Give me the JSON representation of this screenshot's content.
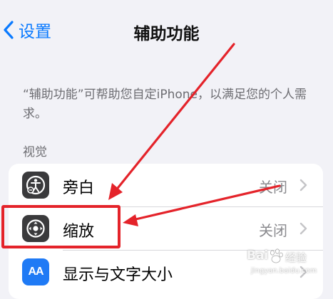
{
  "nav": {
    "back_label": "设置",
    "title": "辅助功能"
  },
  "description": "“辅助功能”可帮助您自定iPhone，以满足您的个人需求。",
  "section_header": "视觉",
  "rows": [
    {
      "label": "旁白",
      "value": "关闭",
      "icon": "voiceover-icon"
    },
    {
      "label": "缩放",
      "value": "关闭",
      "icon": "zoom-icon"
    },
    {
      "label": "显示与文字大小",
      "value": "",
      "icon": "text-size-icon"
    }
  ],
  "text_size_icon_glyph": "AA",
  "annotation_color": "#e4232a",
  "accent_color": "#0a7aff",
  "watermark": {
    "brand": "Bai",
    "brand_suffix": "经验",
    "url": "jingyan.baidu.com"
  }
}
